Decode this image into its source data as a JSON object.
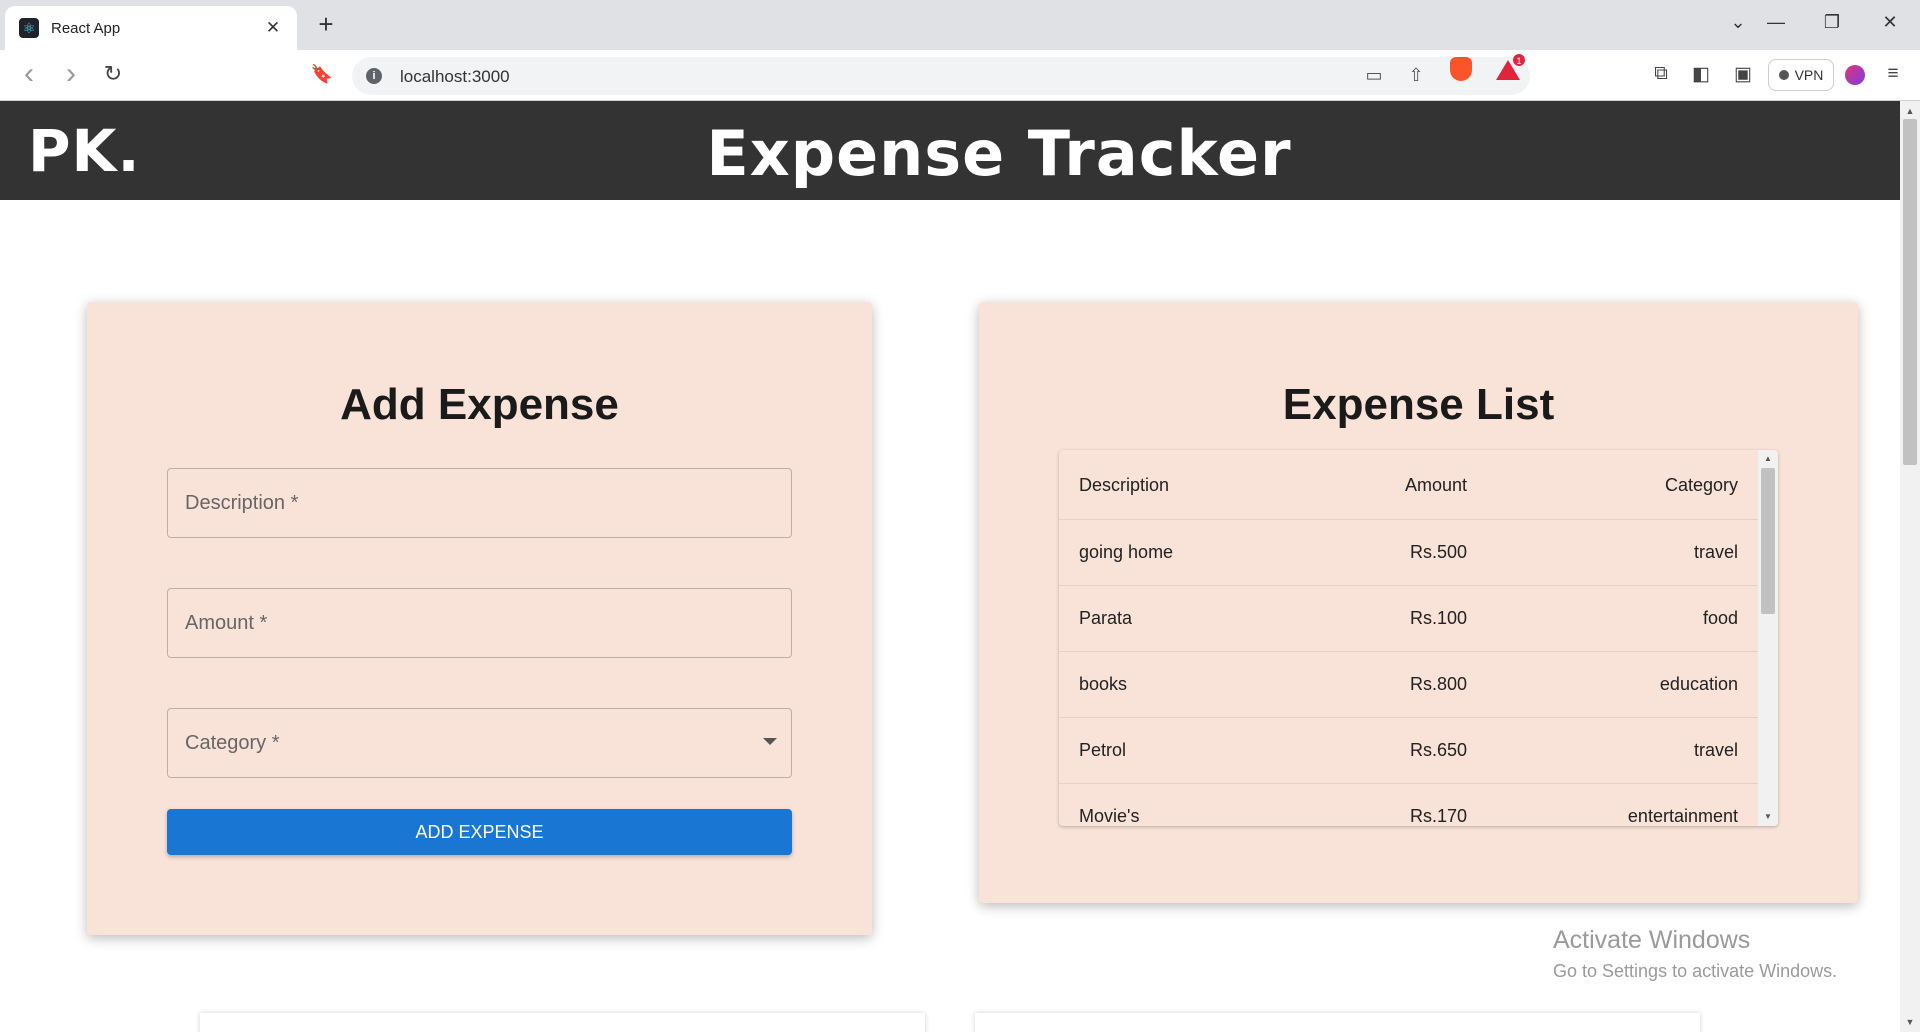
{
  "browser": {
    "tab_title": "React App",
    "tab_close": "✕",
    "new_tab": "+",
    "url": "localhost:3000",
    "vpn_label": "VPN",
    "bat_badge": "1",
    "icons": [
      "react-favicon",
      "back-icon",
      "forward-icon",
      "reload-icon",
      "bookmark-icon",
      "info-icon",
      "cast-icon",
      "share-icon",
      "brave-shields-icon",
      "brave-rewards-icon",
      "extensions-icon",
      "sidebar-icon",
      "wallet-icon",
      "vpn-icon",
      "profile-icon",
      "menu-icon",
      "minimize-icon",
      "restore-icon",
      "close-icon"
    ],
    "controls": {
      "tab_search": "⌄",
      "minimize": "—",
      "restore": "❐",
      "close": "✕",
      "back": "‹",
      "forward": "›",
      "reload": "↻",
      "bookmark": "🔖",
      "cast": "▭",
      "share": "⇧",
      "extensions": "⧉",
      "sidebar": "◧",
      "wallet": "▣",
      "menu": "≡"
    }
  },
  "header": {
    "logo": "PK.",
    "title": "Expense Tracker",
    "background": "#333333"
  },
  "add_expense": {
    "title": "Add Expense",
    "fields": {
      "description": {
        "label": "Description *",
        "value": ""
      },
      "amount": {
        "label": "Amount *",
        "value": ""
      },
      "category": {
        "label": "Category *",
        "value": ""
      }
    },
    "button_label": "ADD EXPENSE",
    "button_color": "#1976d2",
    "card_color": "#f9e2d8"
  },
  "expense_list": {
    "title": "Expense List",
    "columns": [
      "Description",
      "Amount",
      "Category"
    ],
    "rows": [
      {
        "description": "going home",
        "amount": "Rs.500",
        "category": "travel"
      },
      {
        "description": "Parata",
        "amount": "Rs.100",
        "category": "food"
      },
      {
        "description": "books",
        "amount": "Rs.800",
        "category": "education"
      },
      {
        "description": "Petrol",
        "amount": "Rs.650",
        "category": "travel"
      },
      {
        "description": "Movie's",
        "amount": "Rs.170",
        "category": "entertainment"
      }
    ]
  },
  "watermark": {
    "line1": "Activate Windows",
    "line2": "Go to Settings to activate Windows."
  }
}
